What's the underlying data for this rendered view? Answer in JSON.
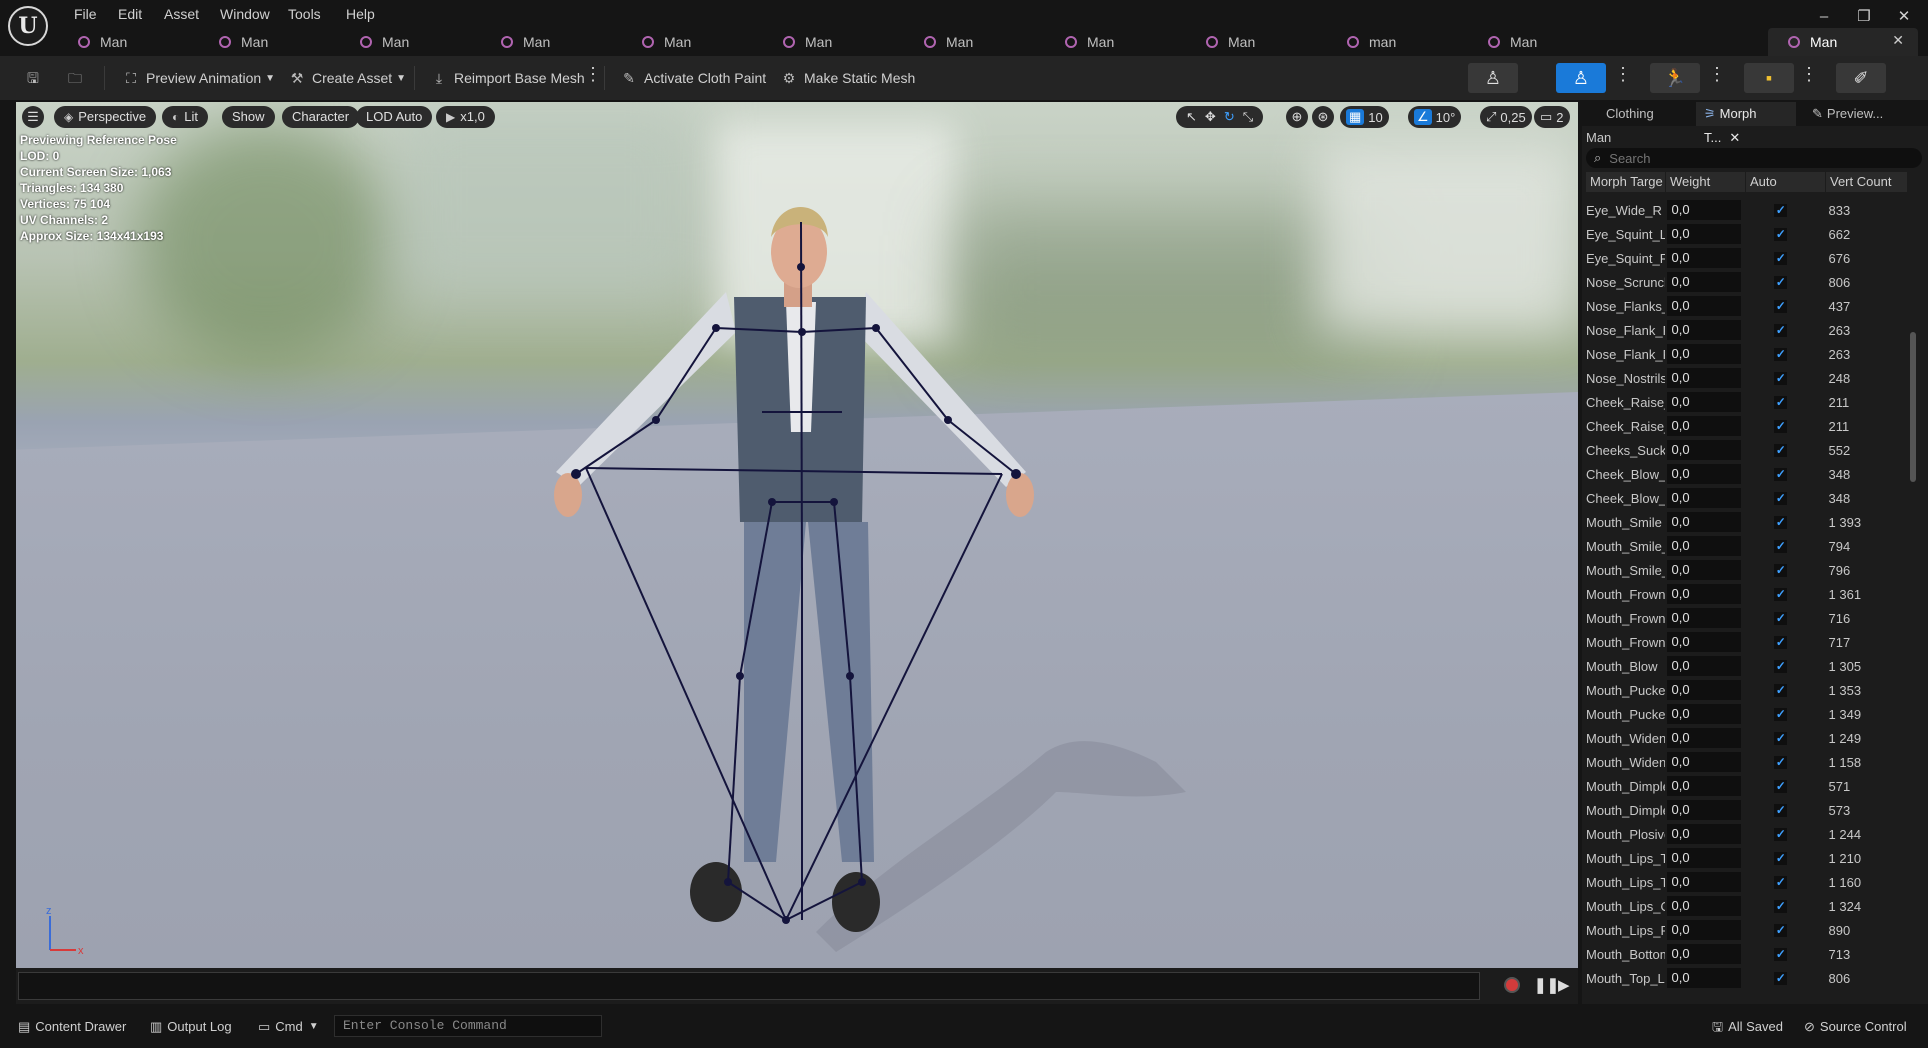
{
  "menu": [
    "File",
    "Edit",
    "Asset",
    "Window",
    "Tools",
    "Help"
  ],
  "window_controls": {
    "minimize": "–",
    "restore": "❐",
    "close": "✕"
  },
  "tabs": [
    {
      "label": "Man"
    },
    {
      "label": "Man"
    },
    {
      "label": "Man"
    },
    {
      "label": "Man"
    },
    {
      "label": "Man"
    },
    {
      "label": "Man"
    },
    {
      "label": "Man"
    },
    {
      "label": "Man"
    },
    {
      "label": "Man"
    },
    {
      "label": "man"
    },
    {
      "label": "Man"
    },
    {
      "label": "Man",
      "active": true
    }
  ],
  "toolbar": {
    "preview_animation": "Preview Animation",
    "create_asset": "Create Asset",
    "reimport_base_mesh": "Reimport Base Mesh",
    "activate_cloth_paint": "Activate Cloth Paint",
    "make_static_mesh": "Make Static Mesh"
  },
  "viewport": {
    "perspective": "Perspective",
    "lit": "Lit",
    "show": "Show",
    "character": "Character",
    "lod": "LOD Auto",
    "play_rate": "x1,0",
    "grid_snap": "10",
    "rotation_snap": "10°",
    "scale_snap": "0,25",
    "camera_speed": "2",
    "stats": [
      "Previewing Reference Pose",
      "LOD: 0",
      "Current Screen Size: 1,063",
      "Triangles: 134 380",
      "Vertices: 75 104",
      "UV Channels: 2",
      "Approx Size: 134x41x193"
    ],
    "axis_z": "z",
    "axis_x": "x"
  },
  "right_panel": {
    "tabs": [
      "Clothing",
      "Morph T...",
      "Preview..."
    ],
    "asset_name": "Man",
    "search_placeholder": "Search",
    "columns": [
      "Morph Targe",
      "Weight",
      "Auto",
      "Vert Count"
    ],
    "rows": [
      {
        "name": "Eye_Wide_R",
        "weight": "0,0",
        "count": "833"
      },
      {
        "name": "Eye_Squint_L",
        "weight": "0,0",
        "count": "662"
      },
      {
        "name": "Eye_Squint_R",
        "weight": "0,0",
        "count": "676"
      },
      {
        "name": "Nose_Scrunch",
        "weight": "0,0",
        "count": "806"
      },
      {
        "name": "Nose_Flanks_",
        "weight": "0,0",
        "count": "437"
      },
      {
        "name": "Nose_Flank_R",
        "weight": "0,0",
        "count": "263"
      },
      {
        "name": "Nose_Flank_R",
        "weight": "0,0",
        "count": "263"
      },
      {
        "name": "Nose_Nostrils",
        "weight": "0,0",
        "count": "248"
      },
      {
        "name": "Cheek_Raise_",
        "weight": "0,0",
        "count": "211"
      },
      {
        "name": "Cheek_Raise_",
        "weight": "0,0",
        "count": "211"
      },
      {
        "name": "Cheeks_Suck",
        "weight": "0,0",
        "count": "552"
      },
      {
        "name": "Cheek_Blow_L",
        "weight": "0,0",
        "count": "348"
      },
      {
        "name": "Cheek_Blow_R",
        "weight": "0,0",
        "count": "348"
      },
      {
        "name": "Mouth_Smile",
        "weight": "0,0",
        "count": "1 393"
      },
      {
        "name": "Mouth_Smile_",
        "weight": "0,0",
        "count": "794"
      },
      {
        "name": "Mouth_Smile_",
        "weight": "0,0",
        "count": "796"
      },
      {
        "name": "Mouth_Frown",
        "weight": "0,0",
        "count": "1 361"
      },
      {
        "name": "Mouth_Frown_",
        "weight": "0,0",
        "count": "716"
      },
      {
        "name": "Mouth_Frown_",
        "weight": "0,0",
        "count": "717"
      },
      {
        "name": "Mouth_Blow",
        "weight": "0,0",
        "count": "1 305"
      },
      {
        "name": "Mouth_Pucker",
        "weight": "0,0",
        "count": "1 353"
      },
      {
        "name": "Mouth_Pucker",
        "weight": "0,0",
        "count": "1 349"
      },
      {
        "name": "Mouth_Widen",
        "weight": "0,0",
        "count": "1 249"
      },
      {
        "name": "Mouth_Widen_",
        "weight": "0,0",
        "count": "1 158"
      },
      {
        "name": "Mouth_Dimple",
        "weight": "0,0",
        "count": "571"
      },
      {
        "name": "Mouth_Dimple",
        "weight": "0,0",
        "count": "573"
      },
      {
        "name": "Mouth_Plosive",
        "weight": "0,0",
        "count": "1 244"
      },
      {
        "name": "Mouth_Lips_T",
        "weight": "0,0",
        "count": "1 210"
      },
      {
        "name": "Mouth_Lips_T",
        "weight": "0,0",
        "count": "1 160"
      },
      {
        "name": "Mouth_Lips_O",
        "weight": "0,0",
        "count": "1 324"
      },
      {
        "name": "Mouth_Lips_P",
        "weight": "0,0",
        "count": "890"
      },
      {
        "name": "Mouth_Bottom",
        "weight": "0,0",
        "count": "713"
      },
      {
        "name": "Mouth_Top_Li",
        "weight": "0,0",
        "count": "806"
      }
    ]
  },
  "statusbar": {
    "content_drawer": "Content Drawer",
    "output_log": "Output Log",
    "cmd": "Cmd",
    "console_placeholder": "Enter Console Command",
    "all_saved": "All Saved",
    "source_control": "Source Control"
  },
  "colors": {
    "accent": "#1a7ad9",
    "record": "#d23b3b",
    "bone": "#14143c"
  }
}
